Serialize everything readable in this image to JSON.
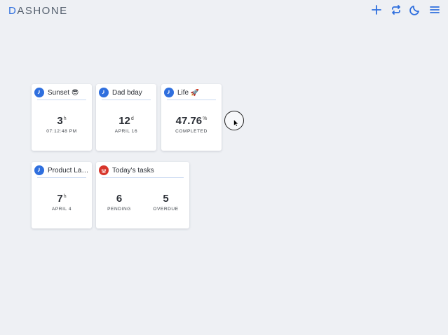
{
  "app": {
    "logo_first": "D",
    "logo_rest": "ASHONE"
  },
  "toolbar": {
    "add_icon": "plus-icon",
    "sync_icon": "repeat-icon",
    "theme_icon": "moon-icon",
    "menu_icon": "hamburger-menu-icon"
  },
  "colors": {
    "accent": "#2f6fde",
    "todoist_red": "#d7352b",
    "background": "#eef0f4",
    "card": "#ffffff"
  },
  "cards": [
    {
      "title": "Sunset 😎",
      "icon": "clock-icon",
      "value": "3",
      "unit": "h",
      "subtitle": "07:12:48 PM"
    },
    {
      "title": "Dad bday",
      "icon": "clock-icon",
      "value": "12",
      "unit": "d",
      "subtitle": "APRIL 16"
    },
    {
      "title": "Life 🚀",
      "icon": "clock-icon",
      "value": "47.76",
      "unit": "%",
      "subtitle": "COMPLETED"
    },
    {
      "title": "Product Laun...",
      "icon": "clock-icon",
      "value": "7",
      "unit": "h",
      "subtitle": "APRIL 4"
    }
  ],
  "tasks_card": {
    "title": "Today's tasks",
    "icon": "todoist-icon",
    "pending_value": "6",
    "pending_label": "PENDING",
    "overdue_value": "5",
    "overdue_label": "OVERDUE"
  }
}
